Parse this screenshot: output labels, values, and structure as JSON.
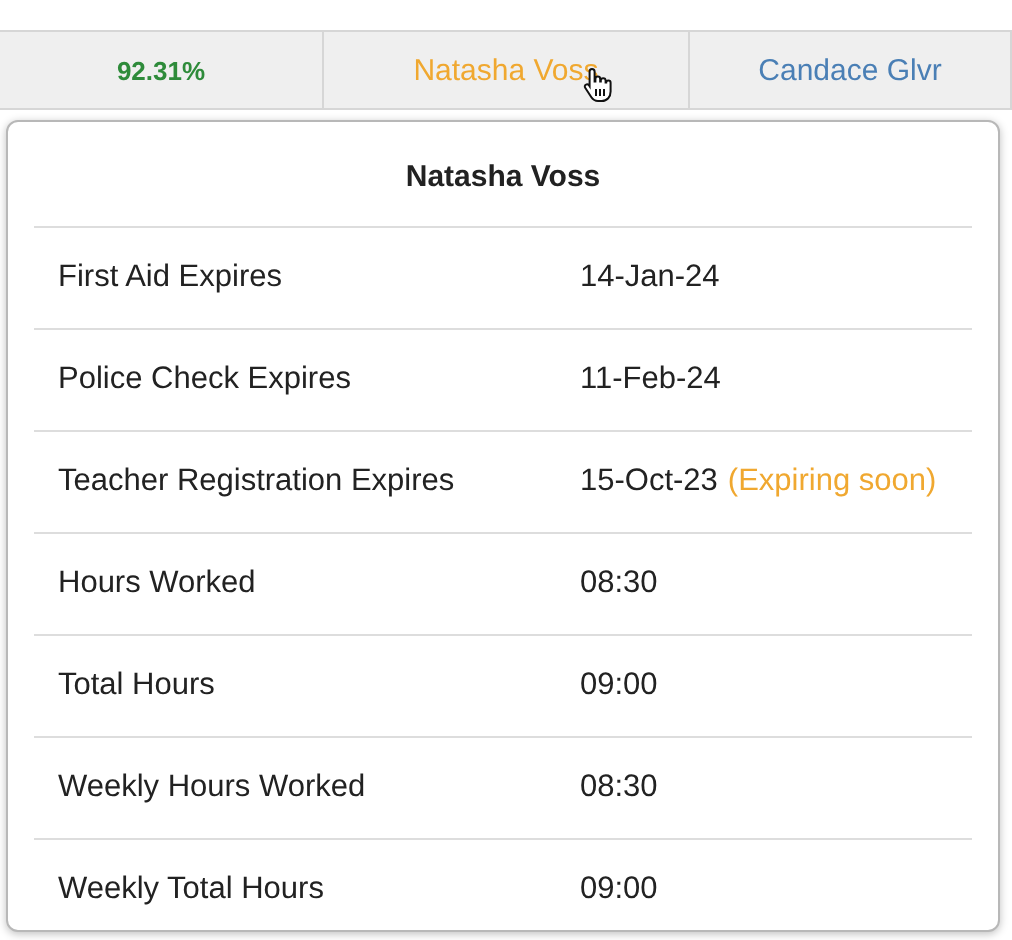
{
  "header_cells": [
    {
      "text": "92.31%",
      "color": "#2e8b3a",
      "bold": true
    },
    {
      "text": "Natasha Voss",
      "color": "#f0a830",
      "bold": false,
      "hovered": true
    },
    {
      "text": "Candace Glvr",
      "color": "#4a7fb5",
      "bold": false,
      "hovered": false
    }
  ],
  "popover": {
    "title": "Natasha Voss",
    "rows": [
      {
        "label": "First Aid Expires",
        "value": "14-Jan-24"
      },
      {
        "label": "Police Check Expires",
        "value": "11-Feb-24"
      },
      {
        "label": "Teacher Registration Expires",
        "value": "15-Oct-23",
        "note": "(Expiring soon)"
      },
      {
        "label": "Hours Worked",
        "value": "08:30"
      },
      {
        "label": "Total Hours",
        "value": "09:00"
      },
      {
        "label": "Weekly Hours Worked",
        "value": "08:30"
      },
      {
        "label": "Weekly Total Hours",
        "value": "09:00"
      }
    ]
  }
}
